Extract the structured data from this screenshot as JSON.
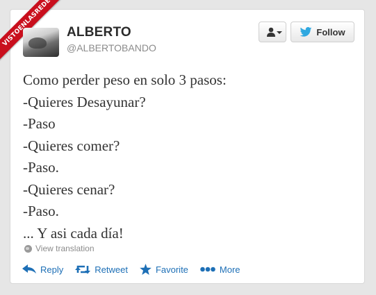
{
  "watermark": {
    "text": "VISTOENLASREDES"
  },
  "tweet": {
    "author_name": "ALBERTO",
    "author_handle": "@ALBERTOBANDO",
    "follow_label": "Follow",
    "lines": [
      "Como perder peso en solo 3 pasos:",
      "-Quieres Desayunar?",
      "-Paso",
      "-Quieres comer?",
      "-Paso.",
      "-Quieres cenar?",
      "-Paso.",
      "... Y asi cada día!"
    ],
    "translation_label": "View translation"
  },
  "actions": {
    "reply": "Reply",
    "retweet": "Retweet",
    "favorite": "Favorite",
    "more": "More"
  },
  "colors": {
    "link_blue": "#1d6fb6",
    "twitter_bird": "#2fa8e0",
    "ribbon_red": "#c90f1d"
  },
  "icons": [
    "person-icon",
    "chevron-down-icon",
    "twitter-bird-icon",
    "globe-icon",
    "reply-icon",
    "retweet-icon",
    "star-icon",
    "more-dots-icon"
  ]
}
